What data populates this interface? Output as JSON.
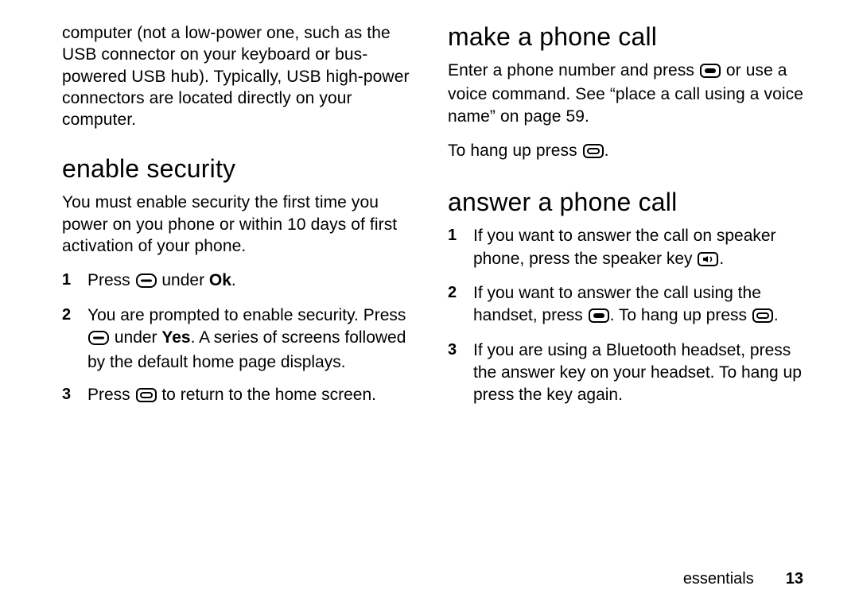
{
  "left": {
    "intro": "computer (not a low-power one, such as the USB connector on your keyboard or bus-powered USB hub). Typically, USB high-power connectors are located directly on your computer.",
    "heading": "enable security",
    "para1": "You must enable security the first time you power on you phone or within 10 days of first activation of your phone.",
    "step1_a": "Press ",
    "step1_b": " under ",
    "step1_ok": "Ok",
    "step1_c": ".",
    "step2_a": "You are prompted to enable security. Press ",
    "step2_b": " under ",
    "step2_yes": "Yes",
    "step2_c": ". A series of screens followed by the default home page displays.",
    "step3_a": "Press ",
    "step3_b": " to return to the home screen."
  },
  "right": {
    "heading1": "make a phone call",
    "para1_a": "Enter a phone number and press ",
    "para1_b": " or use a voice command. See “place a call using a voice name” on page 59.",
    "para2_a": "To hang up press ",
    "para2_b": ".",
    "heading2": "answer a phone call",
    "step1_a": "If you want to answer the call on speaker phone, press the speaker key ",
    "step1_b": ".",
    "step2_a": "If you want to answer the call using the handset, press ",
    "step2_b": ". To hang up press ",
    "step2_c": ".",
    "step3": "If you are using a Bluetooth headset, press the answer key on your headset. To hang up press the key again."
  },
  "footer": {
    "section": "essentials",
    "page": "13"
  },
  "icons": {
    "softkey": "softkey-icon",
    "end": "end-key-icon",
    "send": "send-key-icon",
    "speaker": "speaker-key-icon"
  }
}
